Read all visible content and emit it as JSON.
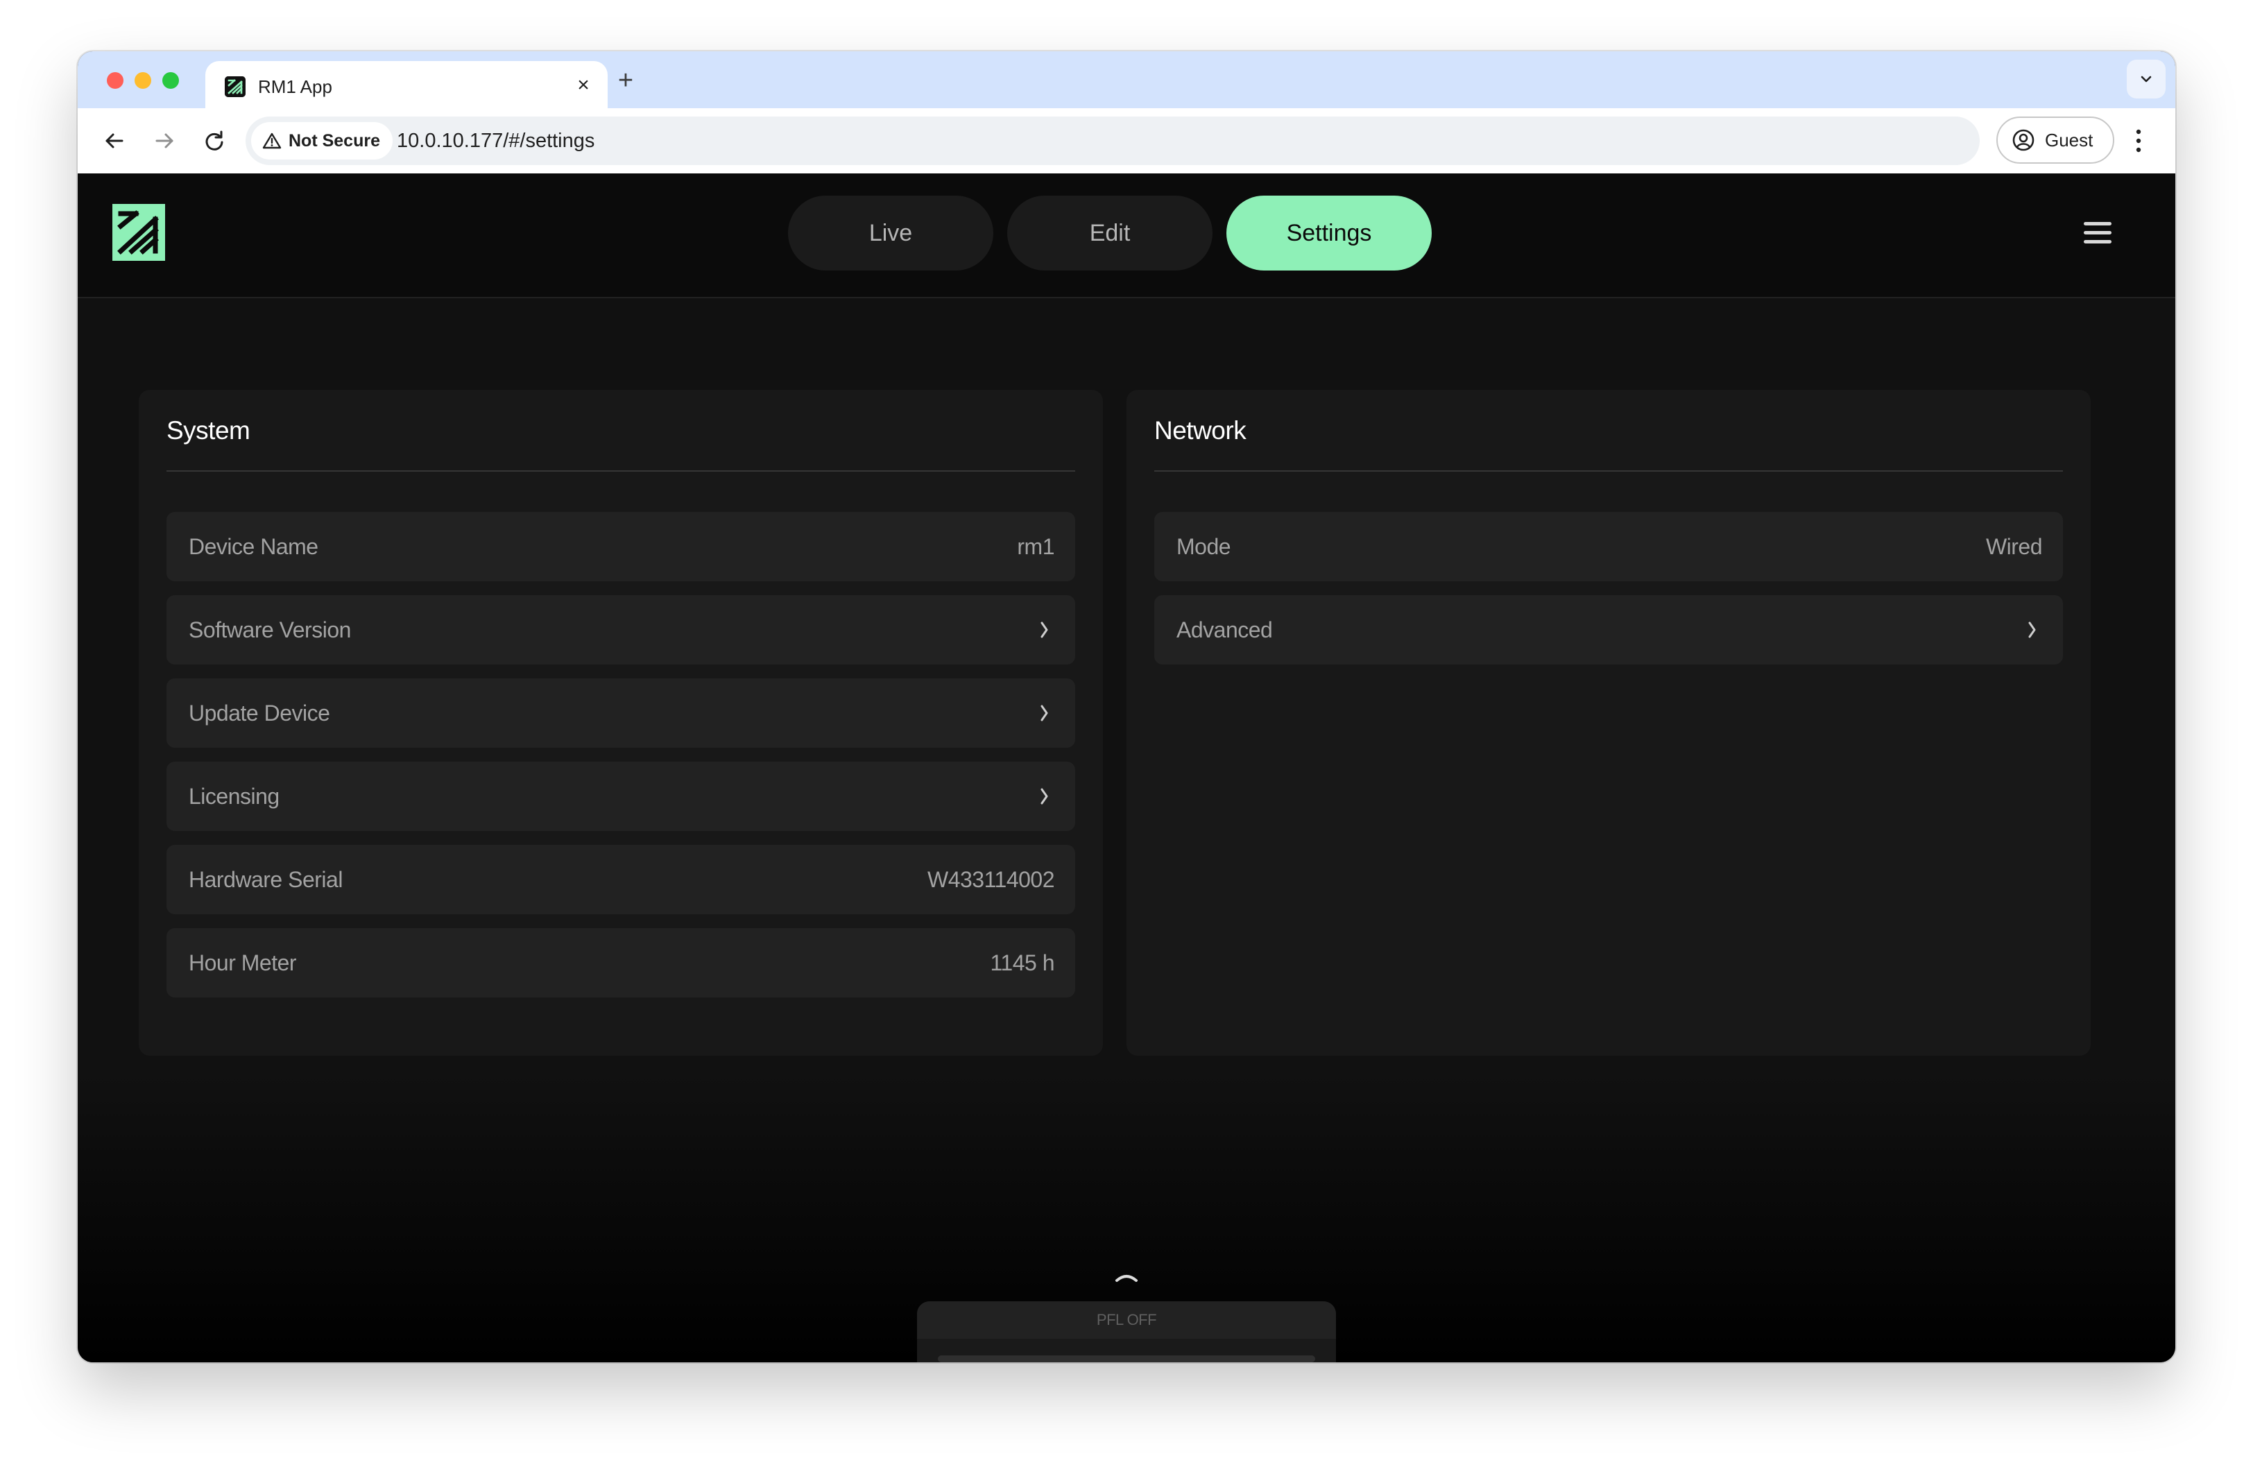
{
  "browser": {
    "tab_title": "RM1 App",
    "tab_close_icon": "close-icon",
    "new_tab_icon": "plus-icon",
    "security_label": "Not Secure",
    "url": "10.0.10.177/#/settings",
    "profile_label": "Guest"
  },
  "app": {
    "nav": {
      "live": "Live",
      "edit": "Edit",
      "settings": "Settings",
      "active": "Settings"
    },
    "accent_color": "#8ef0b7",
    "system": {
      "title": "System",
      "rows": [
        {
          "label": "Device Name",
          "value": "rm1"
        },
        {
          "label": "Software Version",
          "icon": "chevron-right-icon"
        },
        {
          "label": "Update Device",
          "icon": "chevron-right-icon"
        },
        {
          "label": "Licensing",
          "icon": "chevron-right-icon"
        },
        {
          "label": "Hardware Serial",
          "value": "W433114002"
        },
        {
          "label": "Hour Meter",
          "value": "1145 h"
        }
      ]
    },
    "network": {
      "title": "Network",
      "rows": [
        {
          "label": "Mode",
          "value": "Wired"
        },
        {
          "label": "Advanced",
          "icon": "chevron-right-icon"
        }
      ]
    },
    "pfl": {
      "label": "PFL OFF"
    }
  }
}
